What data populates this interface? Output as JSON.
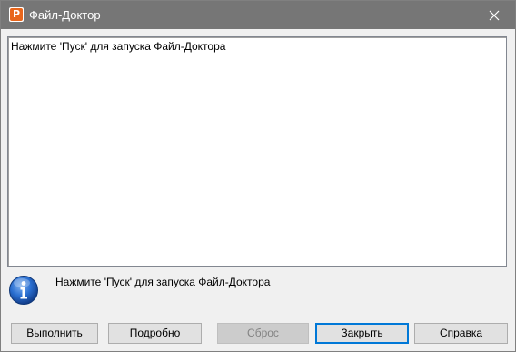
{
  "window": {
    "title": "Файл-Доктор",
    "app_icon_letter": "P",
    "close_icon": "close-icon"
  },
  "log": {
    "lines": [
      "Нажмите 'Пуск' для запуска Файл-Доктора"
    ]
  },
  "status": {
    "icon": "info-icon",
    "text": "Нажмите 'Пуск' для запуска Файл-Доктора"
  },
  "buttons": {
    "run": "Выполнить",
    "details": "Подробно",
    "reset": "Сброс",
    "close": "Закрыть",
    "help": "Справка"
  },
  "colors": {
    "titlebar": "#767676",
    "app_icon": "#e8661c",
    "default_button_border": "#0078d7",
    "info_icon": "#1f5fbf"
  }
}
